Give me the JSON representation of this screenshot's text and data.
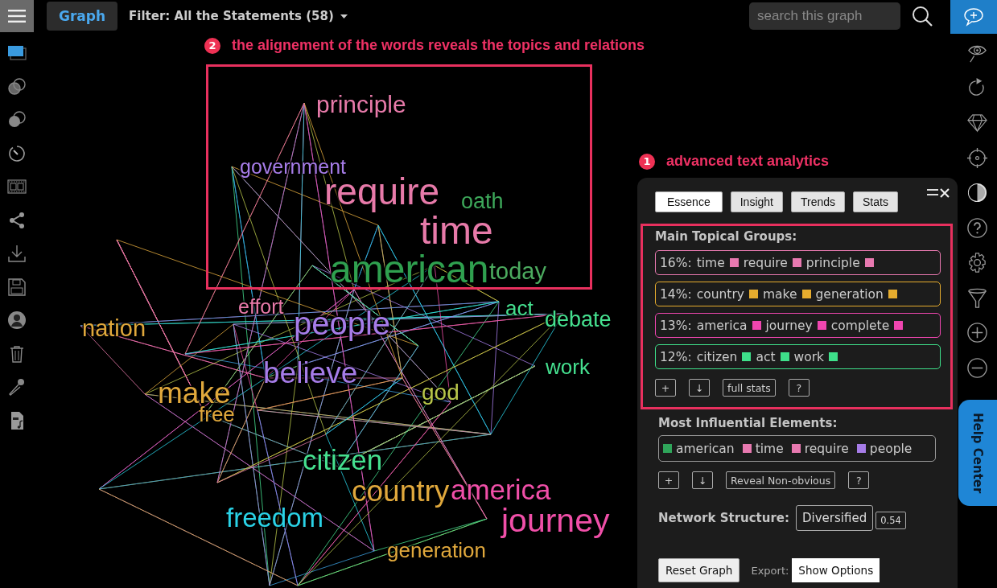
{
  "top_bar": {
    "graph_tab": "Graph",
    "filter": "Filter: All the Statements (58)",
    "search": {
      "placeholder": "search this graph"
    }
  },
  "graph_annotation": {
    "number": "2",
    "text": "the alignement of the words reveals the topics and relations"
  },
  "graph": {
    "nodes": [
      {
        "label": "principle",
        "color": "#e77aa9"
      },
      {
        "label": "government",
        "color": "#a67ce8"
      },
      {
        "label": "require",
        "color": "#e77aa9"
      },
      {
        "label": "oath",
        "color": "#3da85a"
      },
      {
        "label": "time",
        "color": "#e77aa9"
      },
      {
        "label": "american",
        "color": "#2fa04f"
      },
      {
        "label": "today",
        "color": "#4cab5f"
      },
      {
        "label": "effort",
        "color": "#e77aa9"
      },
      {
        "label": "people",
        "color": "#a67ce8"
      },
      {
        "label": "act",
        "color": "#45e08f"
      },
      {
        "label": "debate",
        "color": "#45e08f"
      },
      {
        "label": "nation",
        "color": "#e0a83c"
      },
      {
        "label": "believe",
        "color": "#a67ce8"
      },
      {
        "label": "work",
        "color": "#45e08f"
      },
      {
        "label": "make",
        "color": "#e0a83c"
      },
      {
        "label": "god",
        "color": "#b8c64a"
      },
      {
        "label": "free",
        "color": "#e0a83c"
      },
      {
        "label": "citizen",
        "color": "#45e08f"
      },
      {
        "label": "country",
        "color": "#e0a83c"
      },
      {
        "label": "america",
        "color": "#f04fa8"
      },
      {
        "label": "freedom",
        "color": "#2ad2e6"
      },
      {
        "label": "journey",
        "color": "#f04fa8"
      },
      {
        "label": "generation",
        "color": "#e0a83c"
      }
    ]
  },
  "panel_annotation": {
    "number": "1",
    "text": "advanced text analytics"
  },
  "panel": {
    "tabs": [
      {
        "label": "Essence",
        "selected": true
      },
      {
        "label": "Insight",
        "selected": false
      },
      {
        "label": "Trends",
        "selected": false
      },
      {
        "label": "Stats",
        "selected": false
      }
    ],
    "main_topical_groups": {
      "title": "Main Topical Groups:",
      "groups": [
        {
          "percent": "16%:",
          "color": "#e879b0",
          "words": [
            "time",
            "require",
            "principle"
          ]
        },
        {
          "percent": "14%:",
          "color": "#e6ac2e",
          "words": [
            "country",
            "make",
            "generation"
          ]
        },
        {
          "percent": "13%:",
          "color": "#f046b0",
          "words": [
            "america",
            "journey",
            "complete"
          ]
        },
        {
          "percent": "12%:",
          "color": "#3ee08a",
          "words": [
            "citizen",
            "act",
            "work"
          ]
        }
      ],
      "buttons": [
        "+",
        "↓",
        "full stats",
        "?"
      ]
    },
    "most_influential": {
      "title": "Most Influential Elements:",
      "items": [
        {
          "label": "american",
          "color": "#2fa55a"
        },
        {
          "label": "time",
          "color": "#e879b0"
        },
        {
          "label": "require",
          "color": "#e879b0"
        },
        {
          "label": "people",
          "color": "#a67ce8"
        }
      ],
      "buttons": [
        "+",
        "↓",
        "Reveal Non-obvious",
        "?"
      ]
    },
    "network_structure": {
      "label": "Network Structure:",
      "value": "Diversified",
      "score": "0.54"
    },
    "reset_button": "Reset Graph",
    "export_label": "Export:",
    "export_button": "Show Options"
  },
  "help_tab": "Help Center"
}
